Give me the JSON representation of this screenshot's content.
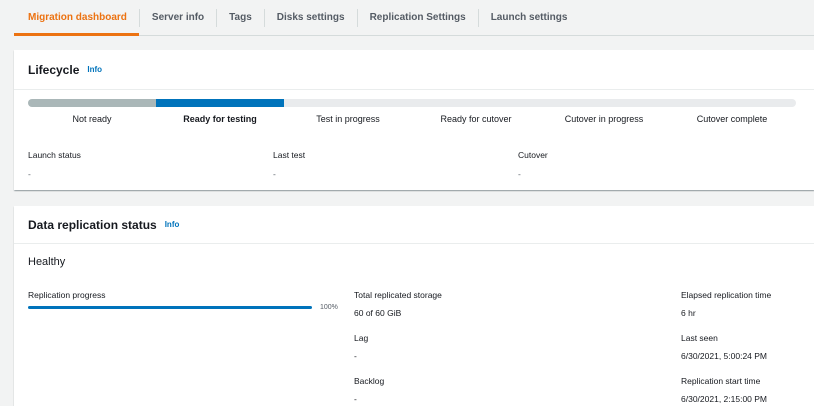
{
  "tabs": [
    {
      "label": "Migration dashboard",
      "active": true
    },
    {
      "label": "Server info",
      "active": false
    },
    {
      "label": "Tags",
      "active": false
    },
    {
      "label": "Disks settings",
      "active": false
    },
    {
      "label": "Replication Settings",
      "active": false
    },
    {
      "label": "Launch settings",
      "active": false
    }
  ],
  "lifecycle": {
    "title": "Lifecycle",
    "info": "Info",
    "steps": [
      {
        "label": "Not ready",
        "state": "done"
      },
      {
        "label": "Ready for testing",
        "state": "current"
      },
      {
        "label": "Test in progress",
        "state": "pending"
      },
      {
        "label": "Ready for cutover",
        "state": "pending"
      },
      {
        "label": "Cutover in progress",
        "state": "pending"
      },
      {
        "label": "Cutover complete",
        "state": "pending"
      }
    ],
    "fields": [
      {
        "label": "Launch status",
        "value": "-"
      },
      {
        "label": "Last test",
        "value": "-"
      },
      {
        "label": "Cutover",
        "value": "-"
      }
    ]
  },
  "replication": {
    "title": "Data replication status",
    "info": "Info",
    "health": "Healthy",
    "progress_label": "Replication progress",
    "progress_percent": 100,
    "progress_text": "100%",
    "middle": [
      {
        "label": "Total replicated storage",
        "value": "60 of 60 GiB"
      },
      {
        "label": "Lag",
        "value": "-"
      },
      {
        "label": "Backlog",
        "value": "-"
      }
    ],
    "right": [
      {
        "label": "Elapsed replication time",
        "value": "6 hr"
      },
      {
        "label": "Last seen",
        "value": "6/30/2021, 5:00:24 PM"
      },
      {
        "label": "Replication start time",
        "value": "6/30/2021, 2:15:00 PM"
      }
    ]
  },
  "colors": {
    "accent": "#ec7211",
    "step_done": "#aab7b8",
    "step_current": "#0073bb",
    "step_pending": "#e9ebed",
    "link": "#0073bb"
  }
}
